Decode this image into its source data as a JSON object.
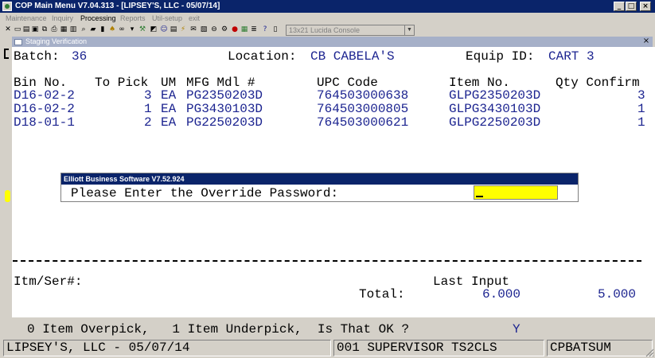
{
  "window": {
    "title": "COP Main Menu V7.04.313 - [LIPSEY'S, LLC - 05/07/14]",
    "minimize_glyph": "_",
    "maximize_glyph": "□",
    "close_glyph": "×"
  },
  "menu": [
    "Maintenance",
    "Inquiry",
    "Processing",
    "Reports",
    "Util-setup",
    "exit"
  ],
  "toolbar": {
    "font_selector": "13x21 Lucida Console"
  },
  "child_window": {
    "title": "Staging Verification",
    "close_glyph": "×"
  },
  "header": {
    "batch_label": "Batch:",
    "batch_value": "36",
    "location_label": "Location:",
    "location_value": "CB CABELA'S",
    "equip_label": "Equip ID:",
    "equip_value": "CART 3"
  },
  "table": {
    "columns": [
      "Bin No.",
      "To Pick",
      "UM",
      "MFG Mdl #",
      "UPC Code",
      "Item No.",
      "Qty Confirm"
    ],
    "rows": [
      {
        "bin": "D16-02-2",
        "to_pick": "3",
        "um": "EA",
        "mfg": "PG2350203D",
        "upc": "764503000638",
        "item": "GLPG2350203D",
        "qty": "3"
      },
      {
        "bin": "D16-02-2",
        "to_pick": "1",
        "um": "EA",
        "mfg": "PG3430103D",
        "upc": "764503000805",
        "item": "GLPG3430103D",
        "qty": "1"
      },
      {
        "bin": "D18-01-1",
        "to_pick": "2",
        "um": "EA",
        "mfg": "PG2250203D",
        "upc": "764503000621",
        "item": "GLPG2250203D",
        "qty": "1"
      }
    ]
  },
  "dialog": {
    "title": "Elliott Business Software V7.52.924",
    "prompt": "Please Enter the Override Password:",
    "password_value": ""
  },
  "footer": {
    "itm_ser_label": "Itm/Ser#:",
    "last_input_label": "Last Input",
    "total_label": "Total:",
    "total_to_pick": "6.000",
    "total_confirmed": "5.000"
  },
  "status_line": {
    "message": "0 Item Overpick,   1 Item Underpick,  Is That OK ?",
    "answer": "Y"
  },
  "status_bar": {
    "company": "LIPSEY'S, LLC - 05/07/14",
    "user": "001 SUPERVISOR TS2CLS",
    "program": "CPBATSUM"
  },
  "colors": {
    "title_bar": "#0a246a",
    "data_text": "#1c2490",
    "highlight": "#ffff00",
    "chrome": "#d4d0c8"
  }
}
